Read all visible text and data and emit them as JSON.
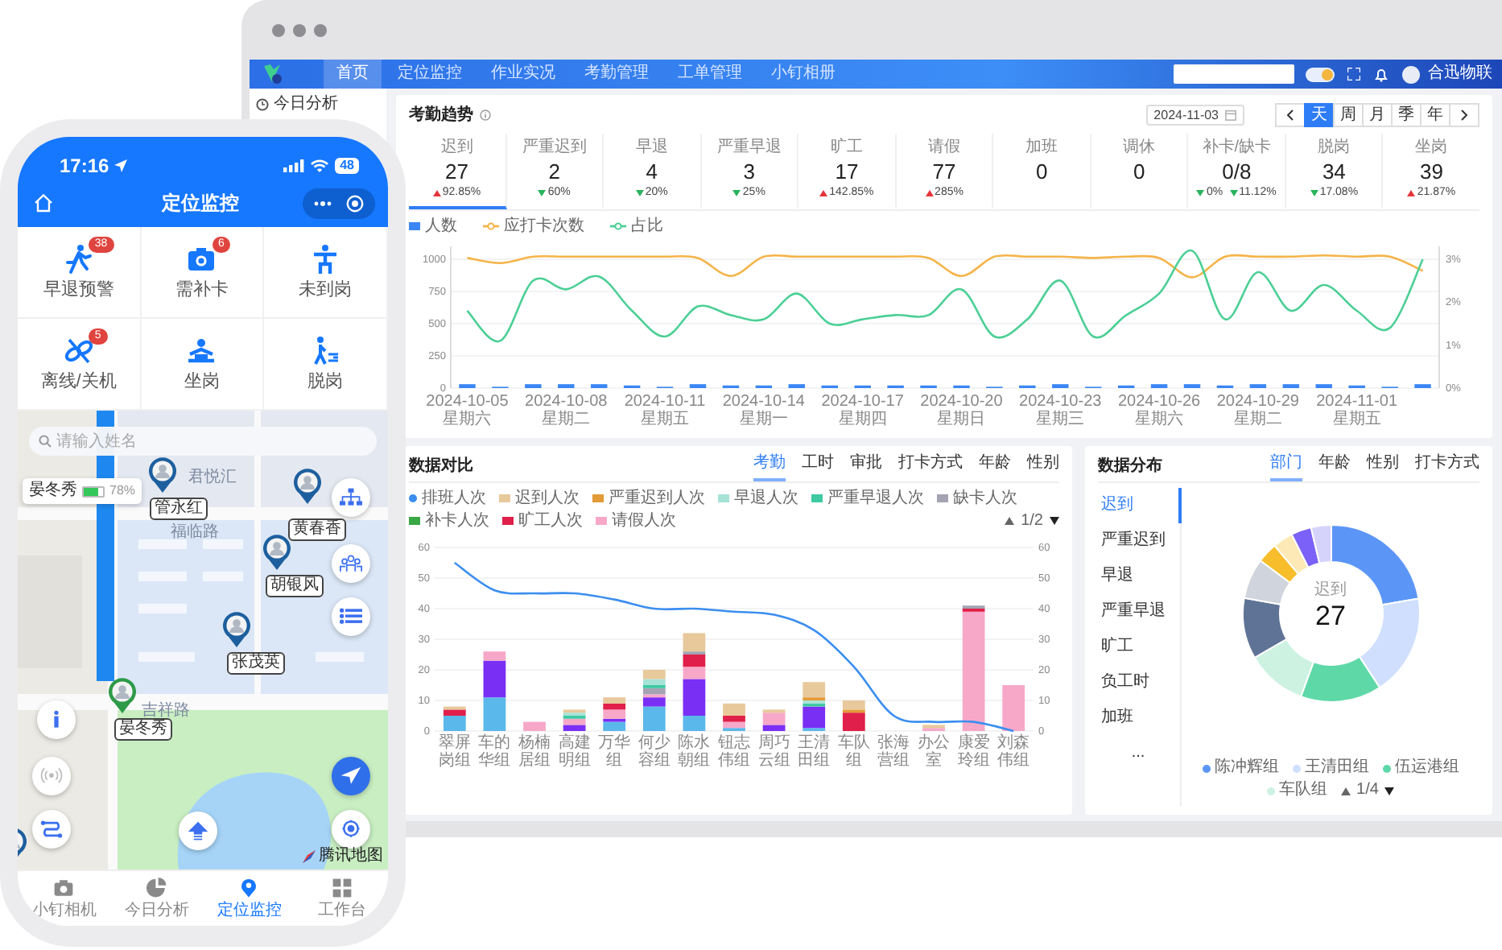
{
  "desktop": {
    "nav": {
      "items": [
        {
          "label": "首页",
          "selected": true
        },
        {
          "label": "定位监控",
          "selected": false
        },
        {
          "label": "作业实况",
          "selected": false
        },
        {
          "label": "考勤管理",
          "selected": false
        },
        {
          "label": "工单管理",
          "selected": false
        },
        {
          "label": "小钉相册",
          "selected": false
        }
      ],
      "theme_switch": {
        "on": true
      },
      "user": "合迅物联"
    },
    "sidebar": {
      "items": [
        {
          "label": "今日分析"
        }
      ]
    },
    "trend": {
      "title": "考勤趋势",
      "date": "2024-11-03",
      "periods": [
        {
          "label": "天",
          "selected": true
        },
        {
          "label": "周",
          "selected": false
        },
        {
          "label": "月",
          "selected": false
        },
        {
          "label": "季",
          "selected": false
        },
        {
          "label": "年",
          "selected": false
        }
      ],
      "stats": [
        {
          "label": "迟到",
          "value": "27",
          "selected": true,
          "changes": [
            {
              "text": "92.85%",
              "rising": true
            }
          ]
        },
        {
          "label": "严重迟到",
          "value": "2",
          "selected": false,
          "changes": [
            {
              "text": "60%",
              "rising": false
            }
          ]
        },
        {
          "label": "早退",
          "value": "4",
          "selected": false,
          "changes": [
            {
              "text": "20%",
              "rising": false
            }
          ]
        },
        {
          "label": "严重早退",
          "value": "3",
          "selected": false,
          "changes": [
            {
              "text": "25%",
              "rising": false
            }
          ]
        },
        {
          "label": "旷工",
          "value": "17",
          "selected": false,
          "changes": [
            {
              "text": "142.85%",
              "rising": true
            }
          ]
        },
        {
          "label": "请假",
          "value": "77",
          "selected": false,
          "changes": [
            {
              "text": "285%",
              "rising": true
            }
          ]
        },
        {
          "label": "加班",
          "value": "0",
          "selected": false
        },
        {
          "label": "调休",
          "value": "0",
          "selected": false
        },
        {
          "label": "补卡/缺卡",
          "value": "0/8",
          "selected": false,
          "changes": [
            {
              "text": "0%",
              "rising": false
            },
            {
              "text": "11.12%",
              "rising": false
            }
          ]
        },
        {
          "label": "脱岗",
          "value": "34",
          "selected": false,
          "changes": [
            {
              "text": "17.08%",
              "rising": false
            }
          ]
        },
        {
          "label": "坐岗",
          "value": "39",
          "selected": false,
          "changes": [
            {
              "text": "21.87%",
              "rising": true
            }
          ]
        }
      ],
      "chart_data": {
        "type": "line",
        "grid": true,
        "categories": [
          "2024-10-05 星期六",
          null,
          null,
          "2024-10-08 星期二",
          null,
          null,
          "2024-10-11 星期五",
          null,
          null,
          "2024-10-14 星期一",
          null,
          null,
          "2024-10-17 星期四",
          null,
          null,
          "2024-10-20 星期日",
          null,
          null,
          "2024-10-23 星期三",
          null,
          null,
          "2024-10-26 星期六",
          null,
          null,
          "2024-10-29 星期二",
          null,
          null,
          "2024-11-01 星期五",
          null,
          null
        ],
        "ylim": [
          0,
          1100
        ],
        "yticks": [
          0,
          250,
          500,
          750,
          1000
        ],
        "y2lim": [
          0,
          3.3
        ],
        "y2ticks": [
          {
            "value": 0,
            "label": "0%"
          },
          {
            "value": 1,
            "label": "1%"
          },
          {
            "value": 2,
            "label": "2%"
          },
          {
            "value": 3,
            "label": "3%"
          }
        ],
        "series": [
          {
            "name": "人数",
            "type": "bar",
            "axis": "y",
            "color": "#3a86f5",
            "values": [
              30,
              10,
              30,
              30,
              30,
              20,
              10,
              30,
              20,
              20,
              30,
              20,
              20,
              20,
              20,
              20,
              10,
              20,
              30,
              10,
              20,
              30,
              30,
              20,
              30,
              30,
              30,
              20,
              10,
              30
            ]
          },
          {
            "name": "应打卡次数",
            "type": "line",
            "axis": "y",
            "color": "#f5b44a",
            "values": [
              1010,
              970,
              1020,
              1020,
              1020,
              1020,
              1020,
              1010,
              870,
              1020,
              1020,
              1020,
              1020,
              1020,
              1010,
              870,
              1020,
              1020,
              1020,
              1010,
              1020,
              1010,
              860,
              1020,
              1020,
              1020,
              1030,
              1020,
              1020,
              910
            ]
          },
          {
            "name": "占比",
            "type": "line",
            "axis": "y2",
            "color": "#4ccf95",
            "values": [
              1.8,
              1.1,
              2.5,
              2.3,
              2.6,
              1.8,
              1.2,
              1.9,
              1.7,
              1.6,
              2.2,
              1.5,
              1.6,
              1.7,
              1.7,
              2.3,
              1.2,
              1.6,
              2.5,
              1.2,
              1.7,
              2.2,
              3.2,
              1.6,
              2.7,
              1.8,
              2.4,
              1.8,
              1.4,
              3.0
            ]
          }
        ]
      }
    },
    "compare": {
      "title": "数据对比",
      "tabs": [
        {
          "label": "考勤",
          "selected": true
        },
        {
          "label": "工时",
          "selected": false
        },
        {
          "label": "审批",
          "selected": false
        },
        {
          "label": "打卡方式",
          "selected": false
        },
        {
          "label": "年龄",
          "selected": false
        },
        {
          "label": "性别",
          "selected": false
        }
      ],
      "legend_pager": "1/2",
      "chart_data": {
        "type": "bar",
        "stacked": true,
        "grid": true,
        "categories": [
          "翠屏岗组",
          "车的华组",
          "杨楠居组",
          "高建明组",
          "万华组",
          "何少容组",
          "陈水朝组",
          "钮志伟组",
          "周巧云组",
          "王清田组",
          "车队组",
          "张海营组",
          "办公室",
          "康爱玲组",
          "刘森伟组"
        ],
        "ylim": [
          0,
          60
        ],
        "yticks": [
          0,
          10,
          20,
          30,
          40,
          50,
          60
        ],
        "y2lim": [
          0,
          60
        ],
        "y2ticks": [
          0,
          10,
          20,
          30,
          40,
          50,
          60
        ],
        "series": [
          {
            "name": "排班人次",
            "type": "line",
            "color": "#3b8ef0",
            "values": [
              55,
              46,
              45,
              45,
              43,
              40,
              40,
              39,
              38,
              33,
              21,
              5,
              3,
              3,
              0
            ]
          },
          {
            "name": "迟到人次",
            "type": "bar",
            "color": "#e8c99c",
            "values": [
              1,
              0,
              0,
              1,
              2,
              3,
              6,
              4,
              1,
              5,
              3,
              0,
              1,
              0,
              0
            ]
          },
          {
            "name": "严重迟到人次",
            "type": "bar",
            "color": "#e39a37",
            "values": [
              0,
              0,
              0,
              0,
              0,
              0,
              0,
              0,
              0,
              1,
              1,
              0,
              0,
              0,
              0
            ]
          },
          {
            "name": "早退人次",
            "type": "bar",
            "color": "#a6e3d7",
            "values": [
              0,
              0,
              0,
              1,
              0,
              2,
              0,
              0,
              0,
              1,
              0,
              0,
              0,
              0,
              0
            ]
          },
          {
            "name": "严重早退人次",
            "type": "bar",
            "color": "#3fc9a3",
            "values": [
              0,
              0,
              0,
              1,
              0,
              1,
              0,
              0,
              0,
              1,
              0,
              0,
              0,
              0,
              0
            ]
          },
          {
            "name": "缺卡人次",
            "type": "bar",
            "color": "#a3a3b3",
            "values": [
              0,
              0,
              0,
              0,
              0,
              2,
              1,
              0,
              0,
              0,
              0,
              0,
              0,
              1,
              0
            ]
          },
          {
            "name": "补卡人次",
            "type": "bar",
            "color": "#3aa845",
            "values": [
              0,
              0,
              0,
              0,
              0,
              0,
              0,
              0,
              0,
              0,
              0,
              0,
              0,
              0,
              0
            ]
          },
          {
            "name": "旷工人次",
            "type": "bar",
            "color": "#e0204a",
            "values": [
              2,
              0,
              0,
              0,
              2,
              0,
              4,
              2,
              0,
              0,
              6,
              0,
              0,
              1,
              0
            ]
          },
          {
            "name": "请假人次",
            "type": "bar",
            "color": "#f7a8c8",
            "values": [
              0,
              3,
              3,
              2,
              3,
              1,
              4,
              2,
              4,
              0,
              0,
              0,
              1,
              39,
              15
            ]
          },
          {
            "type": "bar",
            "color": "#7a2ff5",
            "values": [
              0,
              12,
              0,
              2,
              1,
              3,
              12,
              0,
              2,
              7,
              0,
              0,
              0,
              0,
              0
            ]
          },
          {
            "type": "bar",
            "color": "#5bb8ea",
            "values": [
              5,
              11,
              0,
              0,
              3,
              8,
              5,
              1,
              0,
              1,
              0,
              0,
              0,
              0,
              0
            ]
          }
        ]
      }
    },
    "distribution": {
      "title": "数据分布",
      "tabs": [
        {
          "label": "部门",
          "selected": true
        },
        {
          "label": "年龄",
          "selected": false
        },
        {
          "label": "性别",
          "selected": false
        },
        {
          "label": "打卡方式",
          "selected": false
        }
      ],
      "items": [
        {
          "label": "迟到",
          "selected": true
        },
        {
          "label": "严重迟到",
          "selected": false
        },
        {
          "label": "早退",
          "selected": false
        },
        {
          "label": "严重早退",
          "selected": false
        },
        {
          "label": "旷工",
          "selected": false
        },
        {
          "label": "负工时",
          "selected": false
        },
        {
          "label": "加班",
          "selected": false
        }
      ],
      "more": "...",
      "center_label": "迟到",
      "center_value": "27",
      "legend_pager": "1/4",
      "chart_data": {
        "type": "donut",
        "categories": [
          "陈冲辉组",
          "王清田组",
          "伍运港组",
          "车队组",
          null,
          null,
          null,
          null,
          null,
          null
        ],
        "values": [
          22.3,
          18.5,
          14.8,
          11.1,
          11.1,
          7.4,
          3.7,
          3.7,
          3.7,
          3.7
        ],
        "colors": [
          "#5b96f7",
          "#cfdffd",
          "#5fd8a8",
          "#cdf2e2",
          "#5f7396",
          "#d0d4dc",
          "#f7bd2a",
          "#fce9b5",
          "#7b61f7",
          "#d5d3fb"
        ]
      }
    }
  },
  "phone": {
    "status": {
      "time": "17:16",
      "battery": "48"
    },
    "title": "定位监控",
    "tiles": [
      {
        "label": "早退预警",
        "badge": "38"
      },
      {
        "label": "需补卡",
        "badge": "6"
      },
      {
        "label": "未到岗"
      },
      {
        "label": "离线/关机",
        "badge": "5"
      },
      {
        "label": "坐岗"
      },
      {
        "label": "脱岗"
      }
    ],
    "map": {
      "search": {
        "placeholder": "请输入姓名"
      },
      "place_labels": [
        "君悦汇",
        "福临路",
        "吉祥路"
      ],
      "callout": {
        "name": "晏冬秀",
        "battery": "78%",
        "level": 0.78
      },
      "people": [
        {
          "name": "管永红",
          "selected": false
        },
        {
          "name": "黄春香",
          "selected": false
        },
        {
          "name": "胡银风",
          "selected": false
        },
        {
          "name": "张茂英",
          "selected": false
        },
        {
          "name": "晏冬秀",
          "selected": true
        }
      ],
      "attribution": "腾讯地图"
    },
    "tabs": [
      {
        "label": "小钉相机",
        "selected": false
      },
      {
        "label": "今日分析",
        "selected": false
      },
      {
        "label": "定位监控",
        "selected": true
      },
      {
        "label": "工作台",
        "selected": false
      }
    ]
  }
}
